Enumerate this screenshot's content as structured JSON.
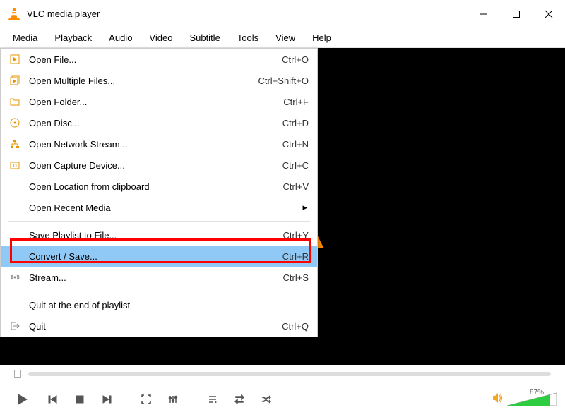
{
  "window": {
    "title": "VLC media player"
  },
  "menubar": [
    "Media",
    "Playback",
    "Audio",
    "Video",
    "Subtitle",
    "Tools",
    "View",
    "Help"
  ],
  "dropdown": [
    {
      "icon": "play-file",
      "label": "Open File...",
      "shortcut": "Ctrl+O"
    },
    {
      "icon": "play-multi",
      "label": "Open Multiple Files...",
      "shortcut": "Ctrl+Shift+O"
    },
    {
      "icon": "folder",
      "label": "Open Folder...",
      "shortcut": "Ctrl+F"
    },
    {
      "icon": "disc",
      "label": "Open Disc...",
      "shortcut": "Ctrl+D"
    },
    {
      "icon": "network",
      "label": "Open Network Stream...",
      "shortcut": "Ctrl+N"
    },
    {
      "icon": "capture",
      "label": "Open Capture Device...",
      "shortcut": "Ctrl+C"
    },
    {
      "icon": "",
      "label": "Open Location from clipboard",
      "shortcut": "Ctrl+V"
    },
    {
      "icon": "",
      "label": "Open Recent Media",
      "shortcut": "",
      "submenu": true
    },
    {
      "sep": true
    },
    {
      "icon": "",
      "label": "Save Playlist to File...",
      "shortcut": "Ctrl+Y"
    },
    {
      "icon": "",
      "label": "Convert / Save...",
      "shortcut": "Ctrl+R",
      "highlighted": true
    },
    {
      "icon": "stream",
      "label": "Stream...",
      "shortcut": "Ctrl+S"
    },
    {
      "sep": true
    },
    {
      "icon": "",
      "label": "Quit at the end of playlist",
      "shortcut": ""
    },
    {
      "icon": "quit",
      "label": "Quit",
      "shortcut": "Ctrl+Q"
    }
  ],
  "volume": {
    "percent": "87%"
  }
}
